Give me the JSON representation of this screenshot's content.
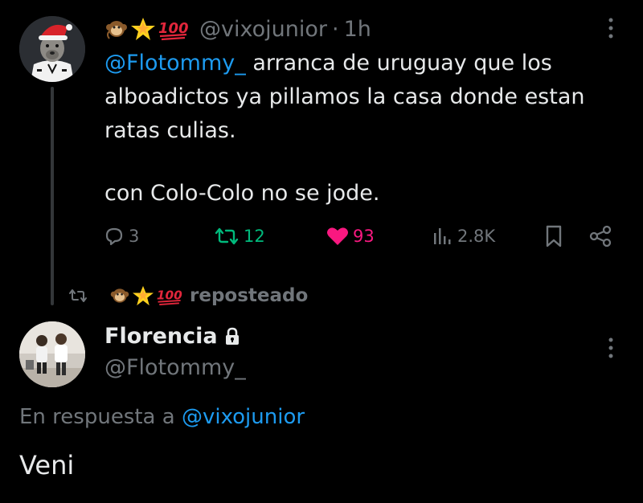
{
  "colors": {
    "background": "#000000",
    "text": "#e7e9ea",
    "secondary": "#71767b",
    "link": "#1d9bf0",
    "retweet": "#00ba7c",
    "like": "#f91880"
  },
  "tweet1": {
    "emojis": [
      "monkey-emoji",
      "star-emoji",
      "hundred-points-emoji"
    ],
    "handle": "@vixojunior",
    "separator": "·",
    "time": "1h",
    "mention": "@Flotommy_",
    "text_line1_rest": " arranca de uruguay que los",
    "text_line2": "alboadictos ya pillamos la casa donde estan",
    "text_line3": "ratas culias.",
    "text_para2": "con Colo-Colo no se jode.",
    "stats": {
      "replies": "3",
      "reposts": "12",
      "likes": "93",
      "views": "2.8K"
    }
  },
  "repost": {
    "label": "reposteado"
  },
  "tweet2": {
    "name": "Florencia",
    "handle": "@Flotommy_",
    "reply_prefix": "En respuesta a ",
    "reply_mention": "@vixojunior",
    "text": "Veni"
  }
}
